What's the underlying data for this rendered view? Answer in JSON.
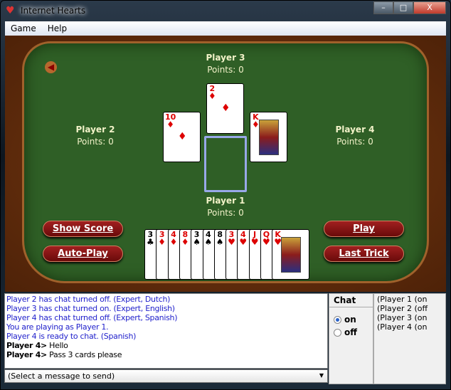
{
  "window": {
    "title": "Internet Hearts",
    "minimize": "–",
    "maximize": "□",
    "close": "X"
  },
  "menu": [
    "Game",
    "Help"
  ],
  "players": {
    "p3": {
      "name": "Player 3",
      "points": "Points: 0"
    },
    "p2": {
      "name": "Player 2",
      "points": "Points: 0"
    },
    "p4": {
      "name": "Player 4",
      "points": "Points: 0"
    },
    "p1": {
      "name": "Player 1",
      "points": "Points: 0"
    }
  },
  "trick": [
    {
      "player": "Player 3",
      "rank": "2",
      "suit": "♦",
      "color": "red"
    },
    {
      "player": "Player 2",
      "rank": "10",
      "suit": "♦",
      "color": "red"
    },
    {
      "player": "Player 4",
      "rank": "K",
      "suit": "♦",
      "color": "red"
    }
  ],
  "hand": [
    {
      "rank": "3",
      "suit": "♣",
      "color": "blk"
    },
    {
      "rank": "3",
      "suit": "♦",
      "color": "red"
    },
    {
      "rank": "4",
      "suit": "♦",
      "color": "red"
    },
    {
      "rank": "8",
      "suit": "♦",
      "color": "red"
    },
    {
      "rank": "3",
      "suit": "♠",
      "color": "blk"
    },
    {
      "rank": "4",
      "suit": "♠",
      "color": "blk"
    },
    {
      "rank": "8",
      "suit": "♠",
      "color": "blk"
    },
    {
      "rank": "3",
      "suit": "♥",
      "color": "red"
    },
    {
      "rank": "4",
      "suit": "♥",
      "color": "red"
    },
    {
      "rank": "J",
      "suit": "♥",
      "color": "red"
    },
    {
      "rank": "Q",
      "suit": "♥",
      "color": "red"
    },
    {
      "rank": "K",
      "suit": "♥",
      "color": "red"
    }
  ],
  "buttons": {
    "show_score": "Show Score",
    "auto_play": "Auto-Play",
    "play": "Play",
    "last_trick": "Last Trick"
  },
  "chat_log": [
    {
      "text": "Player 2 has chat turned off.  (Expert, Dutch)",
      "type": "sys"
    },
    {
      "text": "Player 3 has chat turned on.  (Expert, English)",
      "type": "sys"
    },
    {
      "text": "Player 4 has chat turned off.  (Expert, Spanish)",
      "type": "sys"
    },
    {
      "text": "You are playing as Player 1.",
      "type": "sys"
    },
    {
      "text": "Player 4 is ready to chat.  (Spanish)",
      "type": "sys"
    },
    {
      "speaker": "Player 4>",
      "text": " Hello",
      "type": "msg"
    },
    {
      "speaker": "Player 4>",
      "text": " Pass 3 cards please",
      "type": "msg"
    }
  ],
  "message_select": "(Select a message to send)",
  "chat_panel": {
    "header": "Chat",
    "on": "on",
    "off": "off",
    "selected": "on"
  },
  "player_list": [
    "(Player 1 (on",
    "(Player 2 (off",
    "(Player 3 (on",
    "(Player 4 (on"
  ]
}
